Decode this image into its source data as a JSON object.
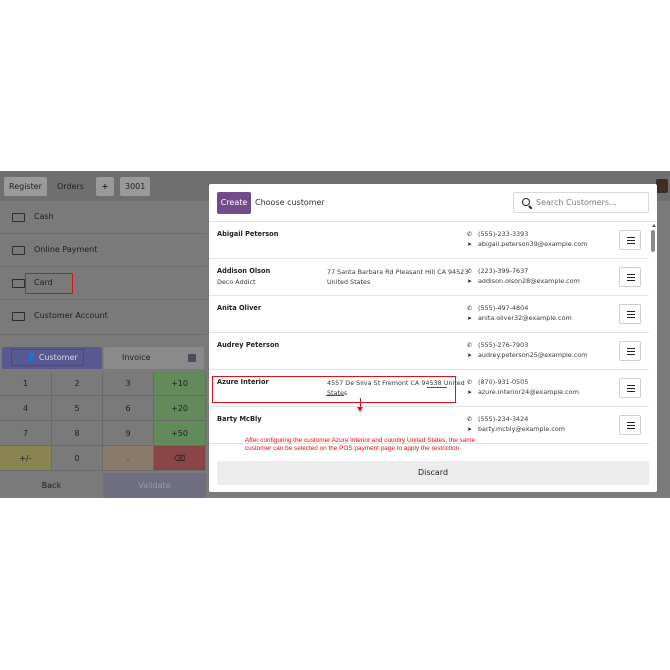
{
  "topbar": {
    "register": "Register",
    "orders": "Orders",
    "add": "+",
    "order_no": "3001"
  },
  "payment_methods": [
    {
      "label": "Cash"
    },
    {
      "label": "Online Payment"
    },
    {
      "label": "Card"
    },
    {
      "label": "Customer Account"
    }
  ],
  "customer_button": "Customer",
  "invoice_button": "Invoice",
  "keypad": [
    "1",
    "2",
    "3",
    "+10",
    "4",
    "5",
    "6",
    "+20",
    "7",
    "8",
    "9",
    "+50",
    "+/-",
    "0",
    ".",
    "⌫"
  ],
  "back_label": "Back",
  "validate_label": "Validate",
  "modal": {
    "create": "Create",
    "title": "Choose customer",
    "search_placeholder": "Search Customers...",
    "discard": "Discard",
    "customers": [
      {
        "name": "Abigail Peterson",
        "sub": "",
        "address": "",
        "address2": "",
        "phone": "(555)-233-3393",
        "email": "abigail.peterson39@example.com"
      },
      {
        "name": "Addison Olson",
        "sub": "Deco Addict",
        "address": "77 Santa Barbara Rd Pleasant Hill CA 94523",
        "address2": "United States",
        "phone": "(223)-399-7637",
        "email": "addison.olson28@example.com"
      },
      {
        "name": "Anita Oliver",
        "sub": "",
        "address": "",
        "address2": "",
        "phone": "(555)-497-4804",
        "email": "anita.oliver32@example.com"
      },
      {
        "name": "Audrey Peterson",
        "sub": "",
        "address": "",
        "address2": "",
        "phone": "(555)-276-7903",
        "email": "audrey.peterson25@example.com"
      },
      {
        "name": "Azure Interior",
        "sub": "",
        "address": "4557 De Silva St Fremont CA 94538 United",
        "address2": "States",
        "phone": "(870)-931-0505",
        "email": "azure.Interior24@example.com"
      },
      {
        "name": "Barty McBly",
        "sub": "",
        "address": "",
        "address2": "",
        "phone": "(555)-234-3424",
        "email": "barty.mcbly@example.com"
      }
    ]
  },
  "annotation": "After configuring the customer Azure Interior and country United States, the same customer can be selected on the POS payment page to apply the restriction.",
  "colors": {
    "accent": "#714b8a",
    "highlight": "#e0101a"
  }
}
